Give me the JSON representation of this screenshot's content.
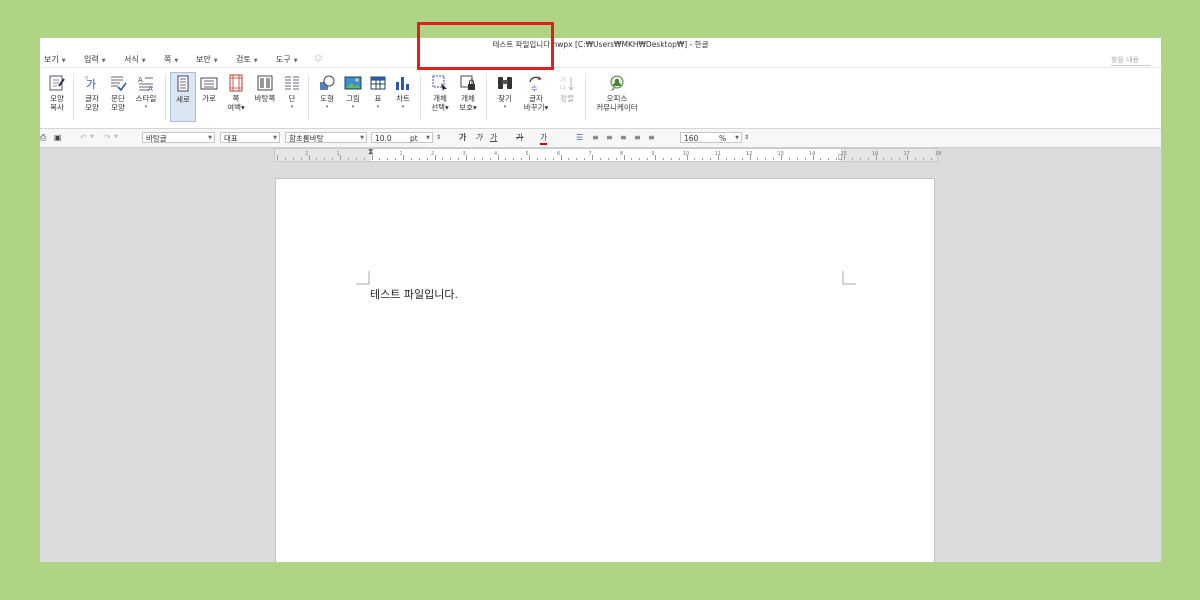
{
  "window": {
    "title": "테스트 파일입니다.hwpx [C:₩Users₩MKH₩Desktop₩] - 한글"
  },
  "menu": {
    "items": [
      "보기",
      "입력",
      "서식",
      "쪽",
      "보안",
      "검토",
      "도구"
    ],
    "help_placeholder": "찾을 내용"
  },
  "ribbon": {
    "buttons": [
      {
        "name": "shape-copy",
        "line1": "모양",
        "line2": "복사"
      },
      {
        "name": "char-shape",
        "line1": "글자",
        "line2": "모양"
      },
      {
        "name": "para-shape",
        "line1": "문단",
        "line2": "모양"
      },
      {
        "name": "style",
        "line1": "스타일",
        "line2": "▾"
      },
      {
        "name": "portrait",
        "line1": "세로",
        "line2": ""
      },
      {
        "name": "landscape",
        "line1": "가로",
        "line2": ""
      },
      {
        "name": "page-margin",
        "line1": "쪽",
        "line2": "여백▾"
      },
      {
        "name": "background",
        "line1": "바탕쪽",
        "line2": ""
      },
      {
        "name": "columns",
        "line1": "단",
        "line2": "▾"
      },
      {
        "name": "shapes",
        "line1": "도형",
        "line2": "▾"
      },
      {
        "name": "picture",
        "line1": "그림",
        "line2": "▾"
      },
      {
        "name": "table",
        "line1": "표",
        "line2": "▾"
      },
      {
        "name": "chart",
        "line1": "차트",
        "line2": "▾"
      },
      {
        "name": "object-select",
        "line1": "개체",
        "line2": "선택▾"
      },
      {
        "name": "object-protect",
        "line1": "개체",
        "line2": "보호▾"
      },
      {
        "name": "find",
        "line1": "찾기",
        "line2": "▾"
      },
      {
        "name": "replace-char",
        "line1": "글자",
        "line2": "바꾸기▾"
      },
      {
        "name": "sort",
        "line1": "정렬",
        "line2": ""
      },
      {
        "name": "office-communicator",
        "line1": "오피스",
        "line2": "커뮤니케이터"
      }
    ]
  },
  "format": {
    "style_name": "바탕글",
    "lang": "대표",
    "font": "함초롬바탕",
    "size": "10.0",
    "unit": "pt",
    "zoom": "160",
    "zoom_unit": "%",
    "bold": "가",
    "italic": "가",
    "underline": "가",
    "strike": "가",
    "color": "가"
  },
  "ruler": {
    "numbers": [
      "2",
      "1",
      "",
      "1",
      "2",
      "3",
      "4",
      "5",
      "6",
      "7",
      "8",
      "9",
      "10",
      "11",
      "12",
      "13",
      "14",
      "15",
      "16",
      "17",
      "18"
    ]
  },
  "document": {
    "text": "테스트 파일입니다."
  },
  "colors": {
    "highlight": "#e02020",
    "background": "#afd485",
    "active_button": "#dbe6f4"
  }
}
